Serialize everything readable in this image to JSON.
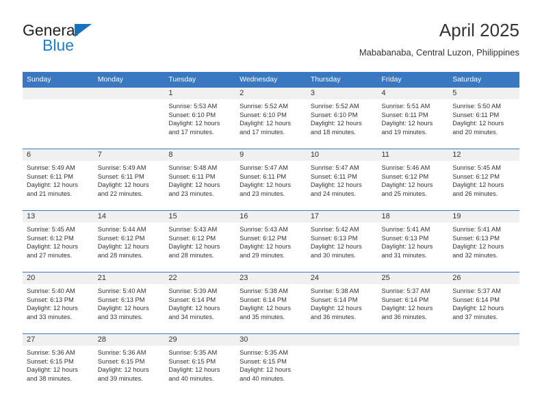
{
  "brand": {
    "name_part1": "General",
    "name_part2": "Blue",
    "logo_icon": "blue-triangle-icon"
  },
  "header": {
    "title": "April 2025",
    "location": "Mababanaba, Central Luzon, Philippines"
  },
  "colors": {
    "header_blue": "#3a79c1",
    "brand_blue": "#1f7ec4",
    "date_strip_gray": "#f0f0f0",
    "text": "#333333"
  },
  "calendar": {
    "weekday_headers": [
      "Sunday",
      "Monday",
      "Tuesday",
      "Wednesday",
      "Thursday",
      "Friday",
      "Saturday"
    ],
    "weeks": [
      [
        {
          "day": "",
          "lines": []
        },
        {
          "day": "",
          "lines": []
        },
        {
          "day": "1",
          "lines": [
            "Sunrise: 5:53 AM",
            "Sunset: 6:10 PM",
            "Daylight: 12 hours",
            "and 17 minutes."
          ]
        },
        {
          "day": "2",
          "lines": [
            "Sunrise: 5:52 AM",
            "Sunset: 6:10 PM",
            "Daylight: 12 hours",
            "and 17 minutes."
          ]
        },
        {
          "day": "3",
          "lines": [
            "Sunrise: 5:52 AM",
            "Sunset: 6:10 PM",
            "Daylight: 12 hours",
            "and 18 minutes."
          ]
        },
        {
          "day": "4",
          "lines": [
            "Sunrise: 5:51 AM",
            "Sunset: 6:11 PM",
            "Daylight: 12 hours",
            "and 19 minutes."
          ]
        },
        {
          "day": "5",
          "lines": [
            "Sunrise: 5:50 AM",
            "Sunset: 6:11 PM",
            "Daylight: 12 hours",
            "and 20 minutes."
          ]
        }
      ],
      [
        {
          "day": "6",
          "lines": [
            "Sunrise: 5:49 AM",
            "Sunset: 6:11 PM",
            "Daylight: 12 hours",
            "and 21 minutes."
          ]
        },
        {
          "day": "7",
          "lines": [
            "Sunrise: 5:49 AM",
            "Sunset: 6:11 PM",
            "Daylight: 12 hours",
            "and 22 minutes."
          ]
        },
        {
          "day": "8",
          "lines": [
            "Sunrise: 5:48 AM",
            "Sunset: 6:11 PM",
            "Daylight: 12 hours",
            "and 23 minutes."
          ]
        },
        {
          "day": "9",
          "lines": [
            "Sunrise: 5:47 AM",
            "Sunset: 6:11 PM",
            "Daylight: 12 hours",
            "and 23 minutes."
          ]
        },
        {
          "day": "10",
          "lines": [
            "Sunrise: 5:47 AM",
            "Sunset: 6:11 PM",
            "Daylight: 12 hours",
            "and 24 minutes."
          ]
        },
        {
          "day": "11",
          "lines": [
            "Sunrise: 5:46 AM",
            "Sunset: 6:12 PM",
            "Daylight: 12 hours",
            "and 25 minutes."
          ]
        },
        {
          "day": "12",
          "lines": [
            "Sunrise: 5:45 AM",
            "Sunset: 6:12 PM",
            "Daylight: 12 hours",
            "and 26 minutes."
          ]
        }
      ],
      [
        {
          "day": "13",
          "lines": [
            "Sunrise: 5:45 AM",
            "Sunset: 6:12 PM",
            "Daylight: 12 hours",
            "and 27 minutes."
          ]
        },
        {
          "day": "14",
          "lines": [
            "Sunrise: 5:44 AM",
            "Sunset: 6:12 PM",
            "Daylight: 12 hours",
            "and 28 minutes."
          ]
        },
        {
          "day": "15",
          "lines": [
            "Sunrise: 5:43 AM",
            "Sunset: 6:12 PM",
            "Daylight: 12 hours",
            "and 28 minutes."
          ]
        },
        {
          "day": "16",
          "lines": [
            "Sunrise: 5:43 AM",
            "Sunset: 6:12 PM",
            "Daylight: 12 hours",
            "and 29 minutes."
          ]
        },
        {
          "day": "17",
          "lines": [
            "Sunrise: 5:42 AM",
            "Sunset: 6:13 PM",
            "Daylight: 12 hours",
            "and 30 minutes."
          ]
        },
        {
          "day": "18",
          "lines": [
            "Sunrise: 5:41 AM",
            "Sunset: 6:13 PM",
            "Daylight: 12 hours",
            "and 31 minutes."
          ]
        },
        {
          "day": "19",
          "lines": [
            "Sunrise: 5:41 AM",
            "Sunset: 6:13 PM",
            "Daylight: 12 hours",
            "and 32 minutes."
          ]
        }
      ],
      [
        {
          "day": "20",
          "lines": [
            "Sunrise: 5:40 AM",
            "Sunset: 6:13 PM",
            "Daylight: 12 hours",
            "and 33 minutes."
          ]
        },
        {
          "day": "21",
          "lines": [
            "Sunrise: 5:40 AM",
            "Sunset: 6:13 PM",
            "Daylight: 12 hours",
            "and 33 minutes."
          ]
        },
        {
          "day": "22",
          "lines": [
            "Sunrise: 5:39 AM",
            "Sunset: 6:14 PM",
            "Daylight: 12 hours",
            "and 34 minutes."
          ]
        },
        {
          "day": "23",
          "lines": [
            "Sunrise: 5:38 AM",
            "Sunset: 6:14 PM",
            "Daylight: 12 hours",
            "and 35 minutes."
          ]
        },
        {
          "day": "24",
          "lines": [
            "Sunrise: 5:38 AM",
            "Sunset: 6:14 PM",
            "Daylight: 12 hours",
            "and 36 minutes."
          ]
        },
        {
          "day": "25",
          "lines": [
            "Sunrise: 5:37 AM",
            "Sunset: 6:14 PM",
            "Daylight: 12 hours",
            "and 36 minutes."
          ]
        },
        {
          "day": "26",
          "lines": [
            "Sunrise: 5:37 AM",
            "Sunset: 6:14 PM",
            "Daylight: 12 hours",
            "and 37 minutes."
          ]
        }
      ],
      [
        {
          "day": "27",
          "lines": [
            "Sunrise: 5:36 AM",
            "Sunset: 6:15 PM",
            "Daylight: 12 hours",
            "and 38 minutes."
          ]
        },
        {
          "day": "28",
          "lines": [
            "Sunrise: 5:36 AM",
            "Sunset: 6:15 PM",
            "Daylight: 12 hours",
            "and 39 minutes."
          ]
        },
        {
          "day": "29",
          "lines": [
            "Sunrise: 5:35 AM",
            "Sunset: 6:15 PM",
            "Daylight: 12 hours",
            "and 40 minutes."
          ]
        },
        {
          "day": "30",
          "lines": [
            "Sunrise: 5:35 AM",
            "Sunset: 6:15 PM",
            "Daylight: 12 hours",
            "and 40 minutes."
          ]
        },
        {
          "day": "",
          "lines": []
        },
        {
          "day": "",
          "lines": []
        },
        {
          "day": "",
          "lines": []
        }
      ]
    ]
  }
}
